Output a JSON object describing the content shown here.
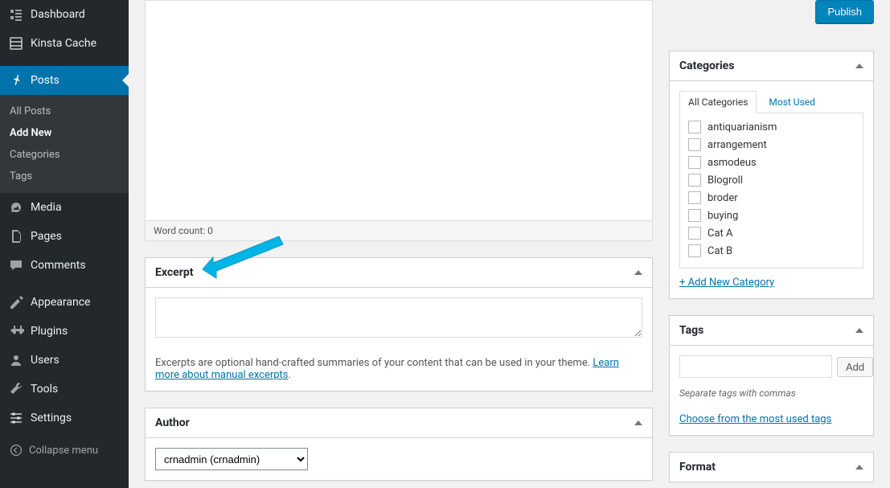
{
  "sidebar": {
    "dashboard": "Dashboard",
    "kinsta_cache": "Kinsta Cache",
    "posts": "Posts",
    "posts_sub": {
      "all": "All Posts",
      "add_new": "Add New",
      "categories": "Categories",
      "tags": "Tags"
    },
    "media": "Media",
    "pages": "Pages",
    "comments": "Comments",
    "appearance": "Appearance",
    "plugins": "Plugins",
    "users": "Users",
    "tools": "Tools",
    "settings": "Settings",
    "collapse": "Collapse menu"
  },
  "editor": {
    "word_count_label": "Word count: 0"
  },
  "excerpt": {
    "title": "Excerpt",
    "value": "",
    "help_text_1": "Excerpts are optional hand-crafted summaries of your content that can be used in your theme. ",
    "help_link": "Learn more about manual excerpts",
    "help_text_2": "."
  },
  "author": {
    "title": "Author",
    "selected": "crnadmin (crnadmin)"
  },
  "publish": {
    "button": "Publish"
  },
  "categories": {
    "title": "Categories",
    "tab_all": "All Categories",
    "tab_most": "Most Used",
    "items": [
      "antiquarianism",
      "arrangement",
      "asmodeus",
      "Blogroll",
      "broder",
      "buying",
      "Cat A",
      "Cat B"
    ],
    "add_new": "+ Add New Category"
  },
  "tags": {
    "title": "Tags",
    "add_btn": "Add",
    "help": "Separate tags with commas",
    "choose_link": "Choose from the most used tags"
  },
  "format": {
    "title": "Format"
  }
}
